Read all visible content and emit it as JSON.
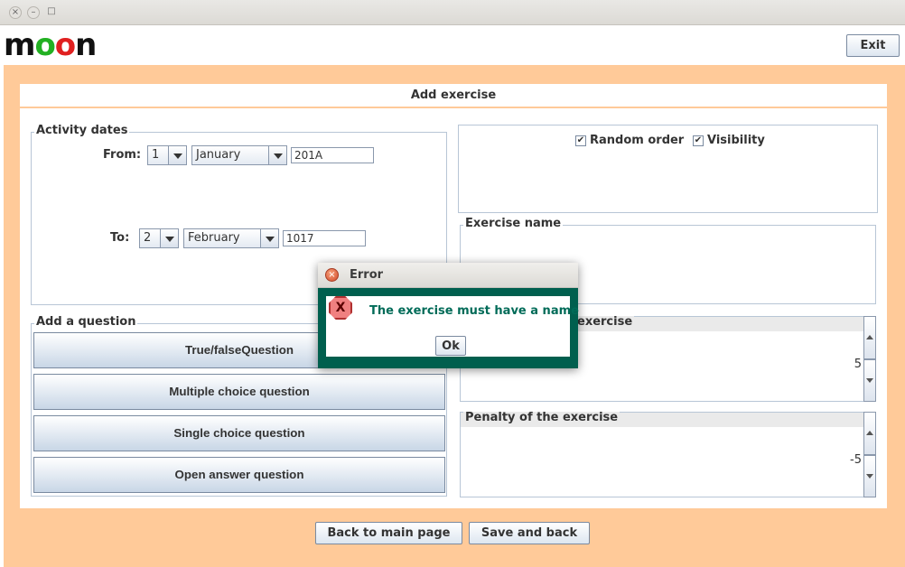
{
  "window": {
    "close_glyph": "×",
    "minimize_glyph": "–",
    "maximize_glyph": "□"
  },
  "header": {
    "logo": {
      "m": "m",
      "o1": "o",
      "o2": "o",
      "n": "n"
    },
    "exit_label": "Exit"
  },
  "page": {
    "title": "Add exercise"
  },
  "activity_dates": {
    "label": "Activity dates",
    "from": {
      "label": "From:",
      "day": "1",
      "month": "January",
      "year": "201A"
    },
    "to": {
      "label": "To:",
      "day": "2",
      "month": "February",
      "year": "1017"
    }
  },
  "options": {
    "random_order": {
      "label": "Random order",
      "checked": "✔"
    },
    "visibility": {
      "label": "Visibility",
      "checked": "✔"
    }
  },
  "exercise_name": {
    "label": "Exercise name",
    "value": ""
  },
  "questions": {
    "label": "Add a question",
    "buttons": [
      "True/falseQuestion",
      "Multiple choice question",
      "Single choice question",
      "Open answer question"
    ]
  },
  "score": {
    "label_visible": "exercise",
    "value": "5"
  },
  "penalty": {
    "label": "Penalty of the exercise",
    "value": "-5"
  },
  "footer": {
    "back_label": "Back to main page",
    "save_label": "Save and back"
  },
  "dialog": {
    "title": "Error",
    "icon_glyph": "X",
    "message": "The exercise must have a name",
    "ok_label": "Ok",
    "close_glyph": "×"
  },
  "colors": {
    "background": "#ffca99",
    "dialog_border": "#005f4e",
    "message_text": "#006b58",
    "logo_green": "#22b022",
    "logo_red": "#e02020"
  }
}
